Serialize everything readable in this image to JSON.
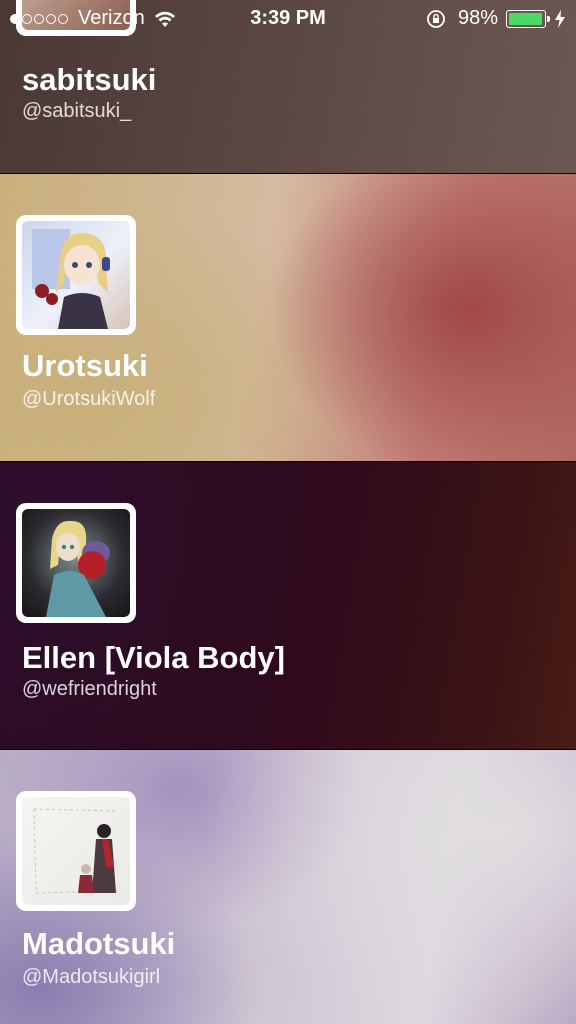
{
  "status_bar": {
    "carrier": "Verizon",
    "signal_bars_filled": 1,
    "signal_bars_total": 5,
    "time": "3:39 PM",
    "battery": "98%",
    "battery_level": 0.98,
    "battery_color": "#4cd964"
  },
  "accounts": [
    {
      "name": "sabitsuki",
      "handle": "@sabitsuki_"
    },
    {
      "name": "Urotsuki",
      "handle": "@UrotsukiWolf"
    },
    {
      "name": "Ellen [Viola Body]",
      "handle": "@wefriendright"
    },
    {
      "name": "Madotsuki",
      "handle": "@Madotsukigirl"
    }
  ]
}
